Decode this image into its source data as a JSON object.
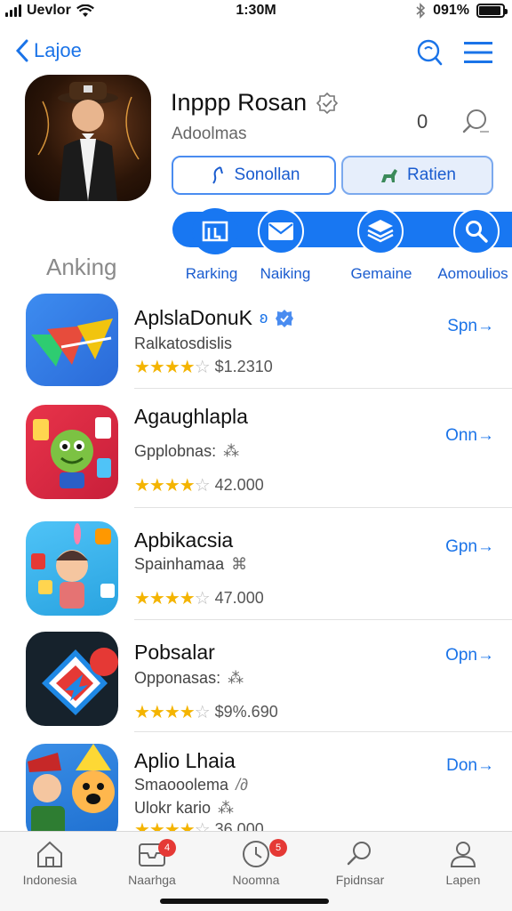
{
  "status_bar": {
    "carrier": "Uevlor",
    "time": "1:30M",
    "battery": "091%",
    "battery_level": 0.91
  },
  "nav": {
    "back_label": "Lajoe"
  },
  "featured": {
    "title": "Inppp Rosan",
    "subtitle": "Adoolmas",
    "count": "0",
    "primary_button": "Sonollan",
    "secondary_button": "Ratien"
  },
  "categories": [
    {
      "label": "Rarking",
      "icon": "book-icon"
    },
    {
      "label": "Naiking",
      "icon": "mail-icon"
    },
    {
      "label": "Gemaine",
      "icon": "layers-icon"
    },
    {
      "label": "Aomoulios",
      "icon": "search-icon"
    }
  ],
  "section_title": "Anking",
  "apps": [
    {
      "name": "AplslaDonuK",
      "subtitle": "Ralkatosdislis",
      "rating_value": "$1.2310",
      "stars": 4,
      "get_label": "Spn→"
    },
    {
      "name": "Agaughlapla",
      "subtitle": "Gpplobnas:",
      "rating_value": "42.000",
      "stars": 4,
      "get_label": "Onn→"
    },
    {
      "name": "Apbikacsia",
      "subtitle": "Spainhamaa",
      "rating_value": "47.000",
      "stars": 4,
      "get_label": "Gpn→"
    },
    {
      "name": "Pobsalar",
      "subtitle": "Opponasas:",
      "rating_value": "$9%.690",
      "stars": 4,
      "get_label": "Opn→"
    },
    {
      "name": "Aplio Lhaia",
      "subtitle": "Smaooolema",
      "subtitle2": "Ulokr kario",
      "rating_value": "36.000",
      "stars": 4,
      "get_label": "Don→"
    }
  ],
  "tabs": [
    {
      "label": "Indonesia",
      "badge": ""
    },
    {
      "label": "Naarhga",
      "badge": "4"
    },
    {
      "label": "Noomna",
      "badge": "5"
    },
    {
      "label": "Fpidnsar",
      "badge": ""
    },
    {
      "label": "Lapen",
      "badge": ""
    }
  ],
  "colors": {
    "accent": "#1877f2",
    "star": "#f4b400",
    "badge": "#e53935"
  }
}
